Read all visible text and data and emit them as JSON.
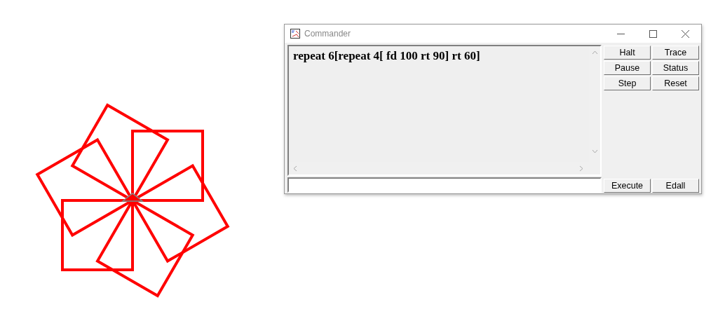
{
  "window": {
    "title": "Commander"
  },
  "editor": {
    "text": "repeat 6[repeat 4[ fd 100 rt 90] rt 60]"
  },
  "buttons": [
    "Halt",
    "Trace",
    "Pause",
    "Status",
    "Step",
    "Reset"
  ],
  "bottom_buttons": [
    "Execute",
    "Edall"
  ]
}
